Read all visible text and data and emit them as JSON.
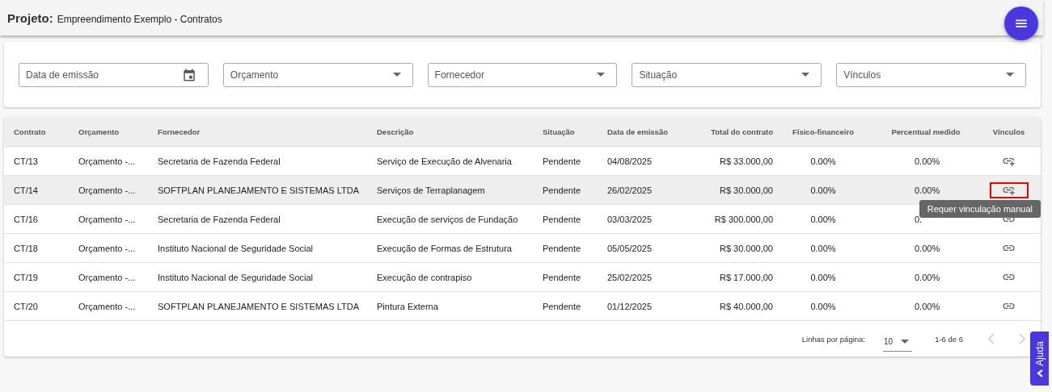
{
  "header": {
    "label": "Projeto:",
    "title": "Empreendimento Exemplo - Contratos"
  },
  "filters": [
    {
      "kind": "date",
      "placeholder": "Data de emissão"
    },
    {
      "kind": "select",
      "placeholder": "Orçamento"
    },
    {
      "kind": "select",
      "placeholder": "Fornecedor"
    },
    {
      "kind": "select",
      "placeholder": "Situação"
    },
    {
      "kind": "select",
      "placeholder": "Vínculos"
    }
  ],
  "table": {
    "columns": [
      "Contrato",
      "Orçamento",
      "Fornecedor",
      "Descrição",
      "Situação",
      "Data de emissão",
      "Total do contrato",
      "Físico-financeiro",
      "Percentual medido",
      "Vínculos"
    ],
    "rows": [
      {
        "cells": [
          "CT/13",
          "Orçamento -...",
          "Secretaria de Fazenda Federal",
          "Serviço de Execução de Alvenaria",
          "Pendente",
          "04/08/2025",
          "R$ 33.000,00",
          "0.00%",
          "0.00%"
        ],
        "manual_link": true,
        "highlighted": false,
        "outlined": false
      },
      {
        "cells": [
          "CT/14",
          "Orçamento -...",
          "SOFTPLAN PLANEJAMENTO E SISTEMAS LTDA",
          "Serviços de Terraplanagem",
          "Pendente",
          "26/02/2025",
          "R$ 30.000,00",
          "0.00%",
          "0.00%"
        ],
        "manual_link": true,
        "highlighted": true,
        "outlined": true,
        "tooltip": "Requer vinculação manual"
      },
      {
        "cells": [
          "CT/16",
          "Orçamento -...",
          "Secretaria de Fazenda Federal",
          "Execução de serviços de Fundação",
          "Pendente",
          "03/03/2025",
          "R$ 300.000,00",
          "0.00%",
          "0."
        ],
        "manual_link": false,
        "highlighted": false,
        "outlined": false
      },
      {
        "cells": [
          "CT/18",
          "Orçamento -...",
          "Instituto Nacional de Seguridade Social",
          "Execução de Formas de Estrutura",
          "Pendente",
          "05/05/2025",
          "R$ 30.000,00",
          "0.00%",
          "0.00%"
        ],
        "manual_link": false,
        "highlighted": false,
        "outlined": false
      },
      {
        "cells": [
          "CT/19",
          "Orçamento -...",
          "Instituto Nacional de Seguridade Social",
          "Execução de contrapiso",
          "Pendente",
          "25/02/2025",
          "R$ 17.000,00",
          "0.00%",
          "0.00%"
        ],
        "manual_link": false,
        "highlighted": false,
        "outlined": false
      },
      {
        "cells": [
          "CT/20",
          "Orçamento -...",
          "SOFTPLAN PLANEJAMENTO E SISTEMAS LTDA",
          "Pintura Externa",
          "Pendente",
          "01/12/2025",
          "R$ 40.000,00",
          "0.00%",
          "0.00%"
        ],
        "manual_link": false,
        "highlighted": false,
        "outlined": false
      }
    ]
  },
  "pagination": {
    "rows_label": "Linhas por página:",
    "rows_per_page": "10",
    "range": "1-6 de 6"
  },
  "help_tab": {
    "label": "Ajuda"
  }
}
